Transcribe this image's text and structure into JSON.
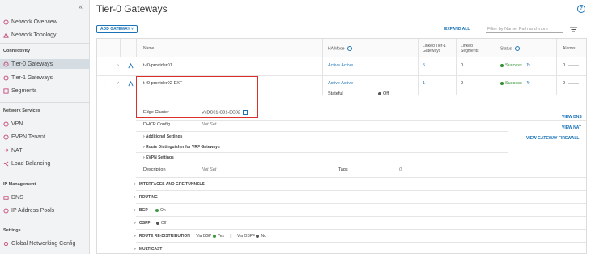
{
  "sidebar": {
    "collapse_icon": "double-chevron-left",
    "items_top": [
      {
        "label": "Network Overview",
        "icon": "network-overview-icon"
      },
      {
        "label": "Network Topology",
        "icon": "network-topology-icon"
      }
    ],
    "sections": [
      {
        "heading": "Connectivity",
        "items": [
          {
            "label": "Tier-0 Gateways",
            "active": true
          },
          {
            "label": "Tier-1 Gateways"
          },
          {
            "label": "Segments"
          }
        ]
      },
      {
        "heading": "Network Services",
        "items": [
          {
            "label": "VPN"
          },
          {
            "label": "EVPN Tenant"
          },
          {
            "label": "NAT"
          },
          {
            "label": "Load Balancing"
          }
        ]
      },
      {
        "heading": "IP Management",
        "items": [
          {
            "label": "DNS"
          },
          {
            "label": "IP Address Pools"
          }
        ]
      },
      {
        "heading": "Settings",
        "items": [
          {
            "label": "Global Networking Config"
          }
        ]
      }
    ]
  },
  "main": {
    "title": "Tier-0 Gateways",
    "add_button": "ADD GATEWAY ˅",
    "expand_all": "EXPAND ALL",
    "filter_placeholder": "Filter by Name, Path and more"
  },
  "table": {
    "headers": {
      "name": "Name",
      "ha_mode": "HA Mode",
      "linked_t1": [
        "Linked Tier-1",
        "Gateways"
      ],
      "linked_segments": [
        "Linked",
        "Segments"
      ],
      "status": "Status",
      "alarms": "Alarms"
    },
    "rows": [
      {
        "name": "t-t0-provider01",
        "ha_mode": "Active Active",
        "linked_t1": "5",
        "linked_segments": "0",
        "status": "Success",
        "alarms": "0"
      },
      {
        "name": "t-t0-provider02-EXT",
        "ha_mode": "Active Active",
        "stateful_label": "Stateful",
        "stateful_value": "Off",
        "linked_t1": "1",
        "linked_segments": "0",
        "status": "Success",
        "alarms": "0"
      }
    ],
    "detail": {
      "edge_cluster_label": "Edge Cluster",
      "edge_cluster_value": "VxDC01-C01-EC02",
      "dhcp_label": "DHCP Config",
      "dhcp_value": "Not Set",
      "additional": "Additional Settings",
      "route_dist": "Route Distinguisher for VRF Gateways",
      "evpn": "EVPN Settings",
      "description_label": "Description",
      "description_value": "Not Set",
      "tags_label": "Tags",
      "tags_value": "0",
      "view_dns": "VIEW DNS",
      "view_nat": "VIEW NAT",
      "view_fw": "VIEW GATEWAY FIREWALL",
      "sections": [
        {
          "label": "INTERFACES AND GRE TUNNELS"
        },
        {
          "label": "ROUTING"
        },
        {
          "label": "BGP",
          "status": "On",
          "color": "#3c9b3c"
        },
        {
          "label": "OSPF",
          "status": "Off",
          "color": "#555555"
        },
        {
          "label": "ROUTE RE-DISTRIBUTION",
          "via_bgp_label": "Via BGP",
          "via_bgp": "Yes",
          "via_ospf_label": "Via OSPF",
          "via_ospf": "No"
        },
        {
          "label": "MULTICAST"
        }
      ]
    }
  },
  "colors": {
    "accent": "#1a73b8",
    "success": "#2f8f2f",
    "highlight": "#d9302c"
  }
}
